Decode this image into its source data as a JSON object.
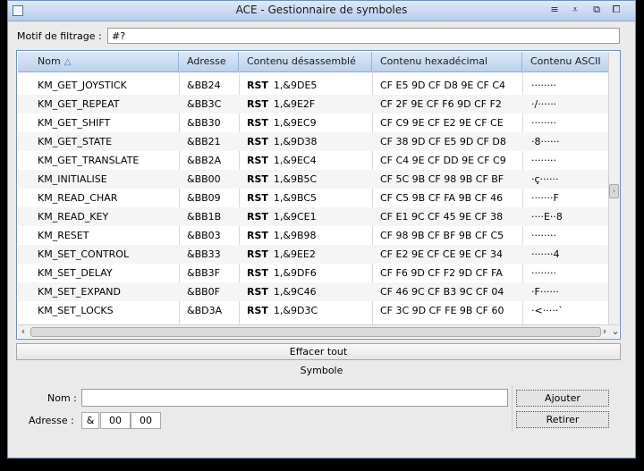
{
  "window": {
    "title": "ACE - Gestionnaire de symboles",
    "icons": [
      "menu-icon",
      "minimize-icon",
      "restore-icon"
    ]
  },
  "filter": {
    "label": "Motif de filtrage :",
    "value": "#?"
  },
  "table": {
    "headers": [
      "Nom",
      "Adresse",
      "Contenu désassemblé",
      "Contenu hexadécimal",
      "Contenu ASCII"
    ],
    "rows": [
      [
        "KM_GET_JOYSTICK",
        "&BB24",
        "RST",
        "1,&9DE5",
        "CF E5 9D CF D8 9E CF C4",
        "········"
      ],
      [
        "KM_GET_REPEAT",
        "&BB3C",
        "RST",
        "1,&9E2F",
        "CF 2F 9E CF F6 9D CF F2",
        "·/······"
      ],
      [
        "KM_GET_SHIFT",
        "&BB30",
        "RST",
        "1,&9EC9",
        "CF C9 9E CF E2 9E CF CE",
        "········"
      ],
      [
        "KM_GET_STATE",
        "&BB21",
        "RST",
        "1,&9D38",
        "CF 38 9D CF E5 9D CF D8",
        "·8······"
      ],
      [
        "KM_GET_TRANSLATE",
        "&BB2A",
        "RST",
        "1,&9EC4",
        "CF C4 9E CF DD 9E CF C9",
        "········"
      ],
      [
        "KM_INITIALISE",
        "&BB00",
        "RST",
        "1,&9B5C",
        "CF 5C 9B CF 98 9B CF BF",
        "·ç······"
      ],
      [
        "KM_READ_CHAR",
        "&BB09",
        "RST",
        "1,&9BC5",
        "CF C5 9B CF FA 9B CF 46",
        "·······F"
      ],
      [
        "KM_READ_KEY",
        "&BB1B",
        "RST",
        "1,&9CE1",
        "CF E1 9C CF 45 9E CF 38",
        "····E··8"
      ],
      [
        "KM_RESET",
        "&BB03",
        "RST",
        "1,&9B98",
        "CF 98 9B CF BF 9B CF C5",
        "········"
      ],
      [
        "KM_SET_CONTROL",
        "&BB33",
        "RST",
        "1,&9EE2",
        "CF E2 9E CF CE 9E CF 34",
        "·······4"
      ],
      [
        "KM_SET_DELAY",
        "&BB3F",
        "RST",
        "1,&9DF6",
        "CF F6 9D CF F2 9D CF FA",
        "········"
      ],
      [
        "KM_SET_EXPAND",
        "&BB0F",
        "RST",
        "1,&9C46",
        "CF 46 9C CF B3 9C CF 04",
        "·F······"
      ],
      [
        "KM_SET_LOCKS",
        "&BD3A",
        "RST",
        "1,&9D3C",
        "CF 3C 9D CF FE 9B CF 60",
        "·<·····`"
      ]
    ]
  },
  "clear_all": "Effacer tout",
  "symbol_section": {
    "title": "Symbole",
    "name_label": "Nom :",
    "name_value": "",
    "address_label": "Adresse :",
    "address_prefix": "&",
    "address_high": "00",
    "address_low": "00",
    "add_button": "Ajouter",
    "remove_button": "Retirer"
  }
}
